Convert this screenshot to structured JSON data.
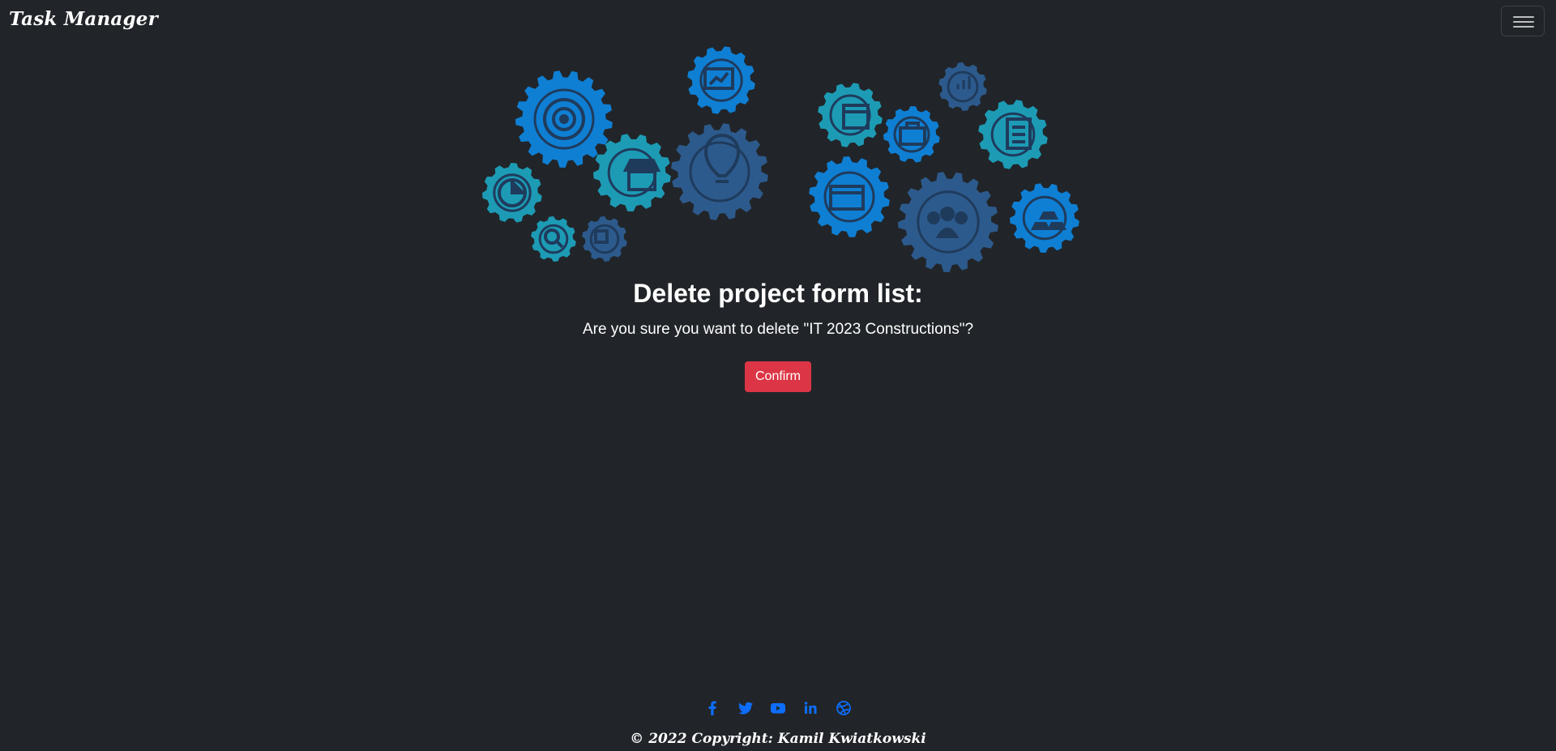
{
  "navbar": {
    "brand": "Task Manager"
  },
  "icons": {
    "menu": "hamburger-menu-icon",
    "gears_illustration": "gears-illustration",
    "social": [
      "facebook-icon",
      "twitter-icon",
      "youtube-icon",
      "linkedin-icon",
      "dribbble-icon"
    ]
  },
  "colors": {
    "background": "#212529",
    "confirm_button": "#dc3545",
    "social_icons": "#0d6efd",
    "gear_blue": "#0f7fd4",
    "gear_teal": "#1d9bb5",
    "gear_navy": "#2d5a8c"
  },
  "main": {
    "title": "Delete project form list:",
    "question": "Are you sure you want to delete \"IT 2023 Constructions\"?",
    "confirm_label": "Confirm"
  },
  "footer": {
    "copyright": "© 2022 Copyright: Kamil Kwiatkowski"
  }
}
